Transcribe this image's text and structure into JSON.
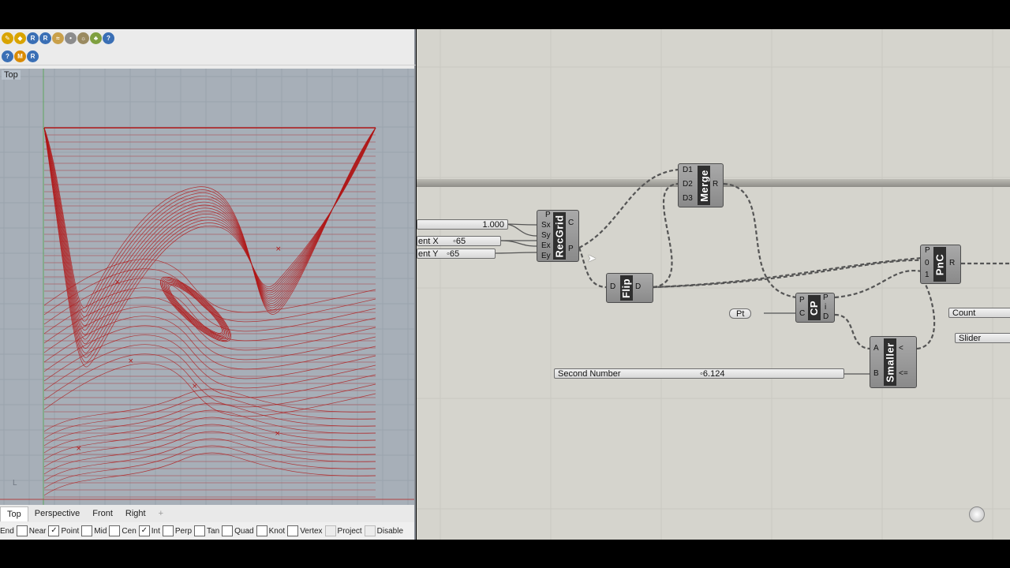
{
  "rhino": {
    "viewport_label": "Top",
    "view_tabs": [
      "Top",
      "Perspective",
      "Front",
      "Right"
    ],
    "add_tab_glyph": "+",
    "osnaps": [
      {
        "label": "End",
        "checked": false
      },
      {
        "label": "Near",
        "checked": false
      },
      {
        "label": "Point",
        "checked": true
      },
      {
        "label": "Mid",
        "checked": false
      },
      {
        "label": "Cen",
        "checked": false
      },
      {
        "label": "Int",
        "checked": true
      },
      {
        "label": "Perp",
        "checked": false
      },
      {
        "label": "Tan",
        "checked": false
      },
      {
        "label": "Quad",
        "checked": false
      },
      {
        "label": "Knot",
        "checked": false
      },
      {
        "label": "Vertex",
        "checked": false
      },
      {
        "label": "Project",
        "checked": false
      },
      {
        "label": "Disable",
        "checked": false
      }
    ],
    "curve_color": "#b01818",
    "viewport_bg": "#a7afb8"
  },
  "gh": {
    "canvas_bg": "#d5d4cd",
    "slider_size": {
      "value": "1.000"
    },
    "slider_ext_x": {
      "label": "ent X",
      "value": "65"
    },
    "slider_ext_y": {
      "label": "ent Y",
      "value": "65"
    },
    "slider_second": {
      "label": "Second Number",
      "value": "6.124"
    },
    "param_pt": {
      "label": "Pt"
    },
    "param_count": {
      "label": "Count"
    },
    "param_slider": {
      "label": "Slider"
    },
    "recgrid": {
      "name": "RecGrid",
      "inputs": [
        "P",
        "Sx",
        "Sy",
        "Ex",
        "Ey"
      ],
      "outputs": [
        "C",
        "P"
      ]
    },
    "merge": {
      "name": "Merge",
      "inputs": [
        "D1",
        "D2",
        "D3"
      ],
      "outputs": [
        "R"
      ]
    },
    "flip": {
      "name": "Flip",
      "inputs": [
        "D"
      ],
      "outputs": [
        "D"
      ]
    },
    "cp": {
      "name": "CP",
      "inputs": [
        "P",
        "C"
      ],
      "outputs": [
        "P",
        "i",
        "D"
      ]
    },
    "smaller": {
      "name": "Smaller",
      "inputs": [
        "A",
        "B"
      ],
      "outputs": [
        "<",
        "<="
      ]
    },
    "pnc": {
      "name": "PnC",
      "inputs": [
        "P",
        "0",
        "1"
      ],
      "outputs": [
        "R"
      ]
    }
  }
}
